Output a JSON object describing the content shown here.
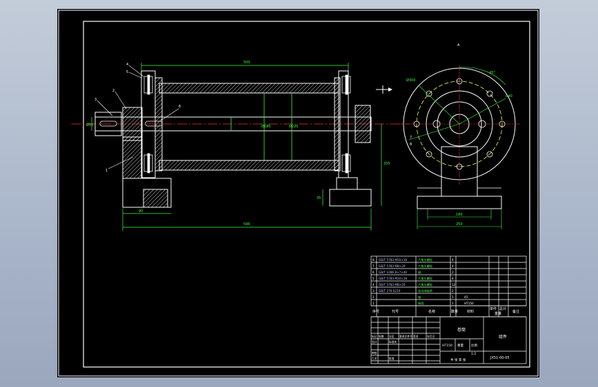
{
  "drawing": {
    "title_block": {
      "part_name": "卷筒",
      "assembly_name": "组件",
      "drawing_number": "JX51-00-05",
      "material": "HT150",
      "scale": "1:2",
      "sheet_info": "共 张 第 张",
      "weight_label": "重量",
      "scale_label": "比例"
    },
    "header_labels": {
      "seq": "序号",
      "code": "代号",
      "name": "名称",
      "qty": "数量",
      "material": "材料",
      "unit_weight": "单件",
      "total_weight": "总计",
      "weight": "重量",
      "note": "备注"
    },
    "signature_labels": [
      "标记",
      "处数",
      "分区",
      "更改文件号",
      "签名",
      "年月日",
      "设计",
      "审核",
      "工艺",
      "标准化",
      "批准"
    ],
    "parts_list": [
      {
        "seq": "8",
        "code": "GB/T 5783 M10×30",
        "name": "六角头螺栓",
        "qty": "4"
      },
      {
        "seq": "7",
        "code": "GB/T 5783 M8×20",
        "name": "六角头螺栓",
        "qty": "4"
      },
      {
        "seq": "6",
        "code": "GB/T 1096 8×7×40",
        "name": "键",
        "qty": "2"
      },
      {
        "seq": "5",
        "code": "GB/T 5783 M10×30",
        "name": "六角头螺栓",
        "qty": "4"
      },
      {
        "seq": "4",
        "code": "GB/T 5783 M8×20",
        "name": "六角头螺栓",
        "qty": "12"
      },
      {
        "seq": "3",
        "code": "GB/T 276 6210",
        "name": "深沟球轴承",
        "qty": "2"
      },
      {
        "seq": "2",
        "code": "",
        "name": "轴",
        "qty": "1",
        "material": "45"
      },
      {
        "seq": "1",
        "code": "",
        "name": "卷筒",
        "qty": "1",
        "material": "HT150"
      }
    ],
    "callouts": [
      "1",
      "2",
      "3",
      "4",
      "5",
      "6",
      "7",
      "8"
    ],
    "dimensions": {
      "overall_length": "596",
      "drum_length": "500",
      "base_length": "90",
      "shaft_dia": "Ø50",
      "drum_inner": "Ø180",
      "drum_outer": "Ø220",
      "center_height": "205",
      "foot_height": "35",
      "base_width": "180",
      "base_total": "250",
      "flange_pcd": "Ø300",
      "bolt_angle": "45°",
      "radius": "R40"
    },
    "view_label": "A"
  }
}
